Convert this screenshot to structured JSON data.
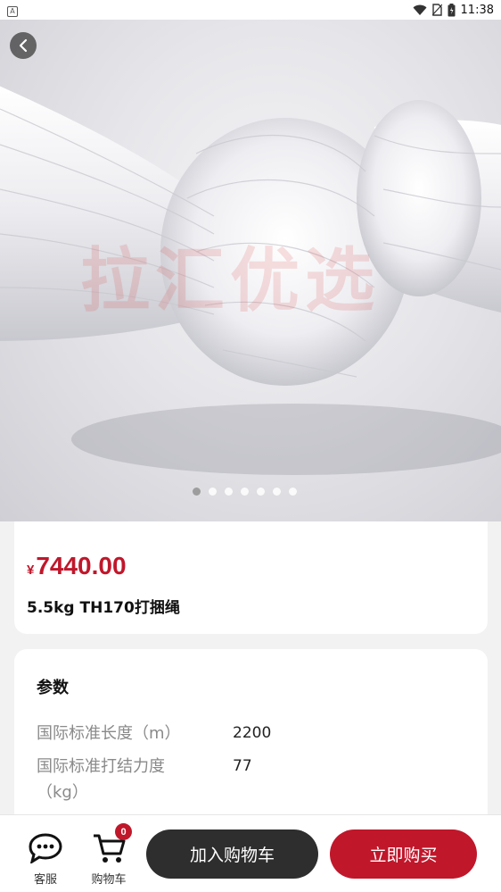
{
  "status_bar": {
    "time": "11:38",
    "app_icon_letter": "A"
  },
  "hero": {
    "watermark": "拉汇优选",
    "image_count": 7,
    "active_index": 0
  },
  "product": {
    "currency": "¥",
    "price": "7440.00",
    "name": "5.5kg TH170打捆绳"
  },
  "params": {
    "title": "参数",
    "rows": [
      {
        "label": "国际标准长度（m）",
        "value": "2200"
      },
      {
        "label": "国际标准打结力度（kg）",
        "label_line1": "国际标准打结力度",
        "label_line2": "（kg）",
        "value": "77"
      }
    ]
  },
  "bottom_bar": {
    "service_label": "客服",
    "cart_label": "购物车",
    "cart_count": "0",
    "add_to_cart": "加入购物车",
    "buy_now": "立即购买"
  },
  "colors": {
    "accent": "#c0172b",
    "dark_button": "#2e2e2e"
  }
}
